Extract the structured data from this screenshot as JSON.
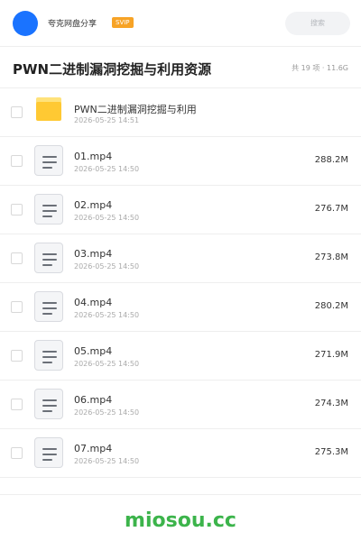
{
  "header": {
    "user_name": "夸克网盘分享",
    "badge": "SVIP",
    "search_placeholder": "搜索"
  },
  "title_bar": {
    "title": "PWN二进制漏洞挖掘与利用资源",
    "summary": "共 19 项 · 11.6G"
  },
  "files": [
    {
      "type": "folder",
      "name": "PWN二进制漏洞挖掘与利用",
      "date": "2026-05-25 14:51",
      "size": ""
    },
    {
      "type": "file",
      "name": "01.mp4",
      "date": "2026-05-25 14:50",
      "size": "288.2M"
    },
    {
      "type": "file",
      "name": "02.mp4",
      "date": "2026-05-25 14:50",
      "size": "276.7M"
    },
    {
      "type": "file",
      "name": "03.mp4",
      "date": "2026-05-25 14:50",
      "size": "273.8M"
    },
    {
      "type": "file",
      "name": "04.mp4",
      "date": "2026-05-25 14:50",
      "size": "280.2M"
    },
    {
      "type": "file",
      "name": "05.mp4",
      "date": "2026-05-25 14:50",
      "size": "271.9M"
    },
    {
      "type": "file",
      "name": "06.mp4",
      "date": "2026-05-25 14:50",
      "size": "274.3M"
    },
    {
      "type": "file",
      "name": "07.mp4",
      "date": "2026-05-25 14:50",
      "size": "275.3M"
    }
  ],
  "footer": {
    "brand": "miosou.cc"
  },
  "colors": {
    "avatar": "#1a73ff",
    "badge": "#f7a326",
    "folder": "#ffc933",
    "brand": "#3cb44b"
  }
}
